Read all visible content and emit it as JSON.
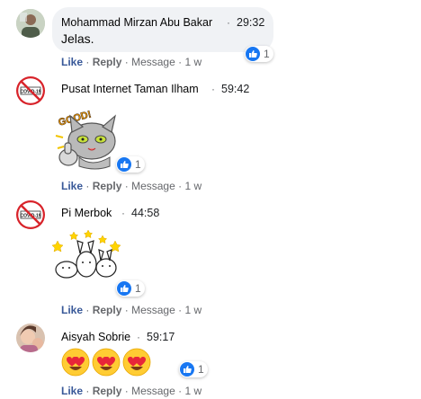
{
  "comments": [
    {
      "author": "Mohammad Mirzan Abu Bakar",
      "time": "29:32",
      "text": "Jelas.",
      "reaction_count": "1",
      "actions": {
        "like": "Like",
        "reply": "Reply",
        "message": "Message",
        "age": "1 w"
      }
    },
    {
      "author": "Pusat Internet Taman Ilham",
      "time": "59:42",
      "sticker_text": "GOOD!",
      "avatar_text": "COVID-19",
      "reaction_count": "1",
      "actions": {
        "like": "Like",
        "reply": "Reply",
        "message": "Message",
        "age": "1 w"
      }
    },
    {
      "author": "Pi Merbok",
      "time": "44:58",
      "avatar_text": "COVID-19",
      "reaction_count": "1",
      "actions": {
        "like": "Like",
        "reply": "Reply",
        "message": "Message",
        "age": "1 w"
      }
    },
    {
      "author": "Aisyah Sobrie",
      "time": "59:17",
      "emoji_name": "heart-eyes-emoji",
      "reaction_count": "1",
      "actions": {
        "like": "Like",
        "reply": "Reply",
        "message": "Message",
        "age": "1 w"
      }
    }
  ],
  "separator": "·",
  "colors": {
    "like": "#385898",
    "secondary": "#65676b",
    "bubble": "#f0f2f5",
    "reaction_blue": "#1877f2"
  }
}
